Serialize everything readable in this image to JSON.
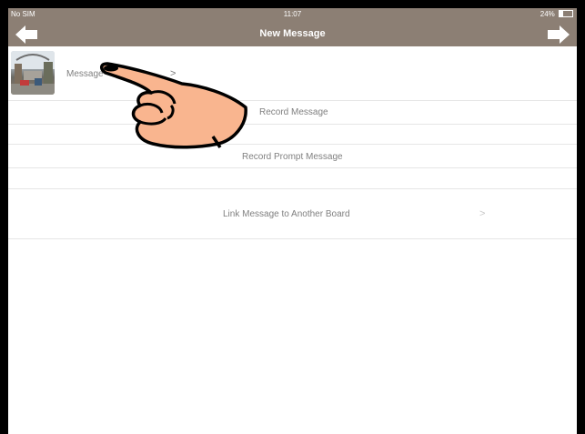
{
  "status_bar": {
    "carrier": "No SIM",
    "time": "11:07",
    "battery": "24%"
  },
  "nav": {
    "title": "New Message",
    "back_icon": "arrow-left-icon",
    "forward_icon": "arrow-right-icon"
  },
  "rows": {
    "message": {
      "label": "Message",
      "chevron": ">"
    },
    "record": {
      "label": "Record Message"
    },
    "record_prompt": {
      "label": "Record Prompt Message"
    },
    "link": {
      "label": "Link Message to Another Board",
      "chevron": ">"
    }
  },
  "colors": {
    "bar": "#8c7f74",
    "hand": "#f9b58f",
    "text": "#808080"
  }
}
